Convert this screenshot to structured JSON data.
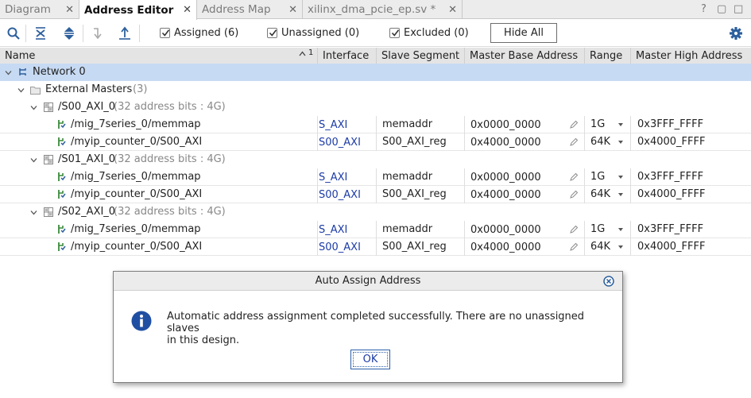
{
  "tabs": [
    {
      "label": "Diagram",
      "active": false
    },
    {
      "label": "Address Editor",
      "active": true
    },
    {
      "label": "Address Map",
      "active": false
    },
    {
      "label": "xilinx_dma_pcie_ep.sv *",
      "active": false
    }
  ],
  "tab_close_glyph": "✕",
  "window_controls": {
    "help": "?",
    "restore": "▢",
    "maximize": "□"
  },
  "toolbar": {
    "assigned": "Assigned (6)",
    "unassigned": "Unassigned (0)",
    "excluded": "Excluded (0)",
    "hide_all": "Hide All"
  },
  "columns": {
    "name": "Name",
    "sort": "1",
    "interface": "Interface",
    "slave_segment": "Slave Segment",
    "master_base": "Master Base Address",
    "range": "Range",
    "master_high": "Master High Address"
  },
  "tree": {
    "network": "Network 0",
    "external": "External Masters",
    "external_count": "(3)",
    "masters": [
      {
        "name": "/S00_AXI_0",
        "info": "(32 address bits : 4G)",
        "slaves": [
          {
            "name": "/mig_7series_0/memmap",
            "interface": "S_AXI",
            "segment": "memaddr",
            "base": "0x0000_0000",
            "range": "1G",
            "high": "0x3FFF_FFFF"
          },
          {
            "name": "/myip_counter_0/S00_AXI",
            "interface": "S00_AXI",
            "segment": "S00_AXI_reg",
            "base": "0x4000_0000",
            "range": "64K",
            "high": "0x4000_FFFF"
          }
        ]
      },
      {
        "name": "/S01_AXI_0",
        "info": "(32 address bits : 4G)",
        "slaves": [
          {
            "name": "/mig_7series_0/memmap",
            "interface": "S_AXI",
            "segment": "memaddr",
            "base": "0x0000_0000",
            "range": "1G",
            "high": "0x3FFF_FFFF"
          },
          {
            "name": "/myip_counter_0/S00_AXI",
            "interface": "S00_AXI",
            "segment": "S00_AXI_reg",
            "base": "0x4000_0000",
            "range": "64K",
            "high": "0x4000_FFFF"
          }
        ]
      },
      {
        "name": "/S02_AXI_0",
        "info": "(32 address bits : 4G)",
        "slaves": [
          {
            "name": "/mig_7series_0/memmap",
            "interface": "S_AXI",
            "segment": "memaddr",
            "base": "0x0000_0000",
            "range": "1G",
            "high": "0x3FFF_FFFF"
          },
          {
            "name": "/myip_counter_0/S00_AXI",
            "interface": "S00_AXI",
            "segment": "S00_AXI_reg",
            "base": "0x4000_0000",
            "range": "64K",
            "high": "0x4000_FFFF"
          }
        ]
      }
    ]
  },
  "dialog": {
    "title": "Auto Assign Address",
    "message_line1": "Automatic address assignment completed successfully. There are no unassigned slaves",
    "message_line2": "in this design.",
    "ok": "OK"
  },
  "colors": {
    "selection": "#c7daf3",
    "link": "#1c3ba7",
    "icon_blue": "#2d5f9c",
    "icon_green": "#3a8a3a",
    "info_blue": "#1f4fa3"
  }
}
